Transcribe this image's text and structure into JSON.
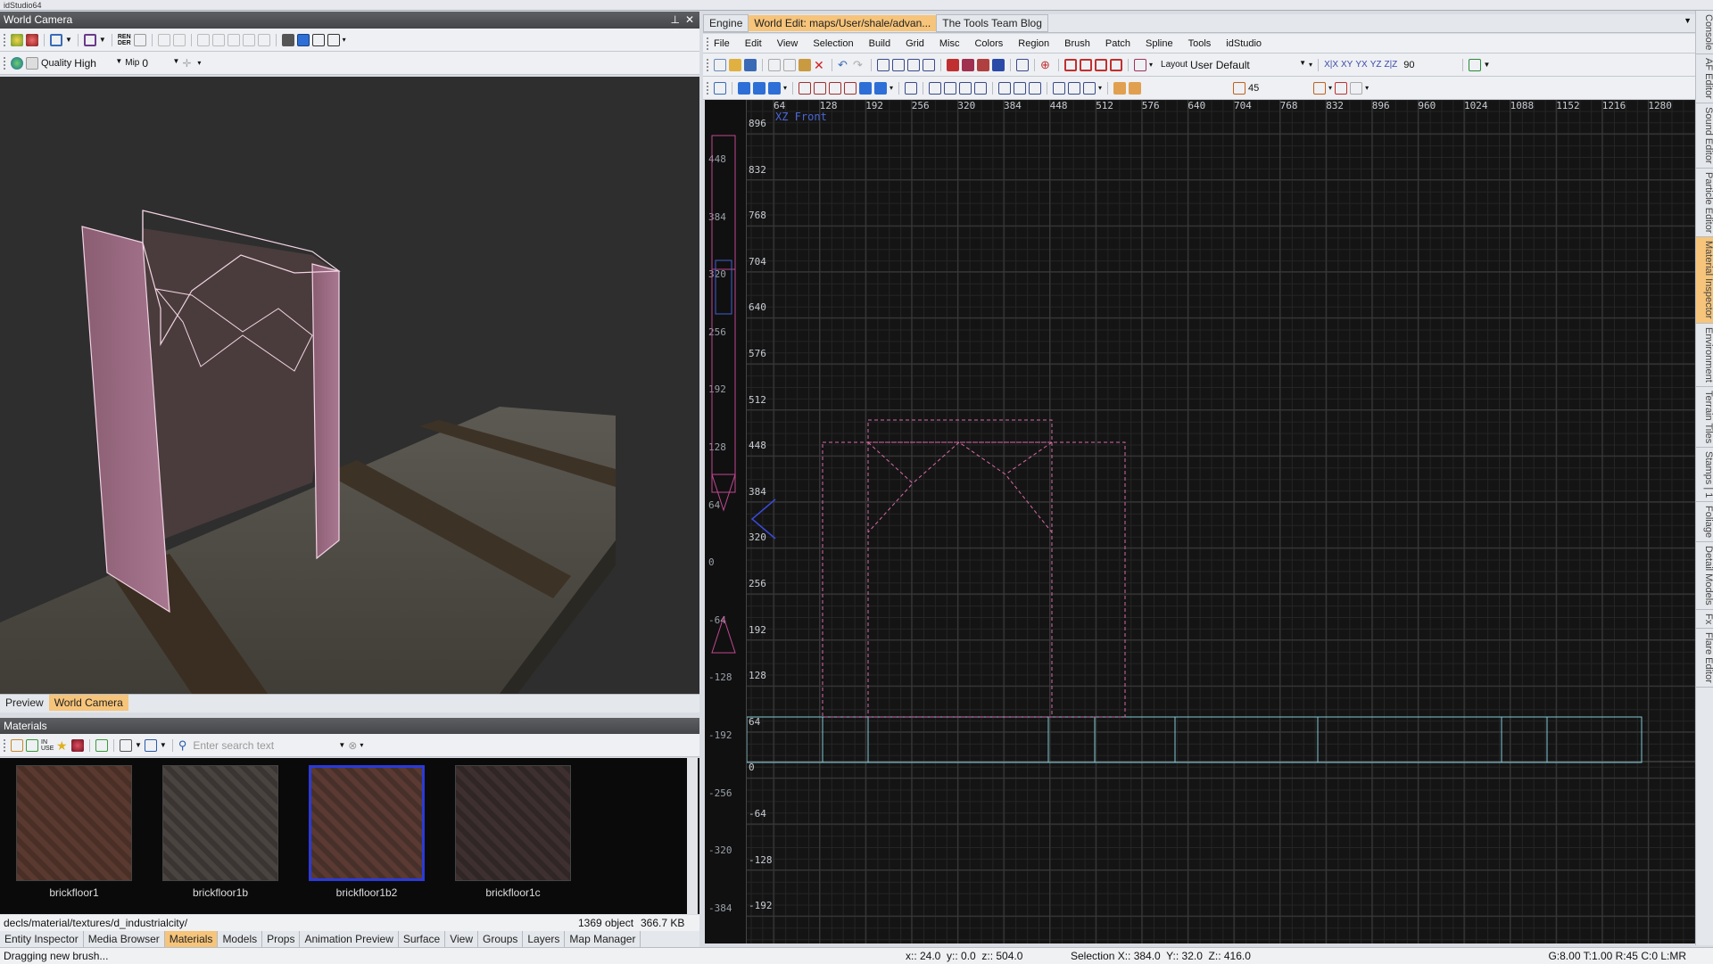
{
  "app": {
    "title": "idStudio64"
  },
  "camera_panel": {
    "title": "World Camera",
    "quality_label": "Quality",
    "quality_value": "High",
    "mip_label": "Mip",
    "mip_value": "0",
    "ren_der_label": "REN\nDER",
    "tabs": [
      {
        "label": "Preview"
      },
      {
        "label": "World Camera"
      }
    ]
  },
  "materials_panel": {
    "title": "Materials",
    "search_placeholder": "Enter search text",
    "items": [
      {
        "name": "brickfloor1"
      },
      {
        "name": "brickfloor1b"
      },
      {
        "name": "brickfloor1b2"
      },
      {
        "name": "brickfloor1c"
      }
    ],
    "path": "decls/material/textures/d_industrialcity/",
    "object_count": "1369 object",
    "size": "366.7 KB"
  },
  "bottom_tabs": [
    {
      "label": "Entity Inspector"
    },
    {
      "label": "Media Browser"
    },
    {
      "label": "Materials"
    },
    {
      "label": "Models"
    },
    {
      "label": "Props"
    },
    {
      "label": "Animation Preview"
    },
    {
      "label": "Surface"
    },
    {
      "label": "View"
    },
    {
      "label": "Groups"
    },
    {
      "label": "Layers"
    },
    {
      "label": "Map Manager"
    }
  ],
  "doc_tabs": [
    {
      "label": "Engine"
    },
    {
      "label": "World Edit: maps/User/shale/advan..."
    },
    {
      "label": "The Tools Team Blog"
    }
  ],
  "menu": [
    {
      "label": "File"
    },
    {
      "label": "Edit"
    },
    {
      "label": "View"
    },
    {
      "label": "Selection"
    },
    {
      "label": "Build"
    },
    {
      "label": "Grid"
    },
    {
      "label": "Misc"
    },
    {
      "label": "Colors"
    },
    {
      "label": "Region"
    },
    {
      "label": "Brush"
    },
    {
      "label": "Patch"
    },
    {
      "label": "Spline"
    },
    {
      "label": "Tools"
    },
    {
      "label": "idStudio"
    }
  ],
  "toolbar": {
    "layout_label": "Layout",
    "layout_value": "User Default",
    "rotate_value": "90",
    "angle_value": "45",
    "axis_labels": [
      "X|X",
      "XY",
      "YX",
      "YZ",
      "Z|Z"
    ]
  },
  "viewport": {
    "view_label": "XZ Front",
    "top_ruler": [
      "64",
      "128",
      "192",
      "256",
      "320",
      "384",
      "448",
      "512",
      "576",
      "640",
      "704",
      "768",
      "832",
      "896",
      "960",
      "1024",
      "1088",
      "1152",
      "1216",
      "1280"
    ],
    "left_ruler": [
      "896",
      "832",
      "768",
      "704",
      "640",
      "576",
      "512",
      "448",
      "384",
      "320",
      "256",
      "192",
      "128",
      "64",
      "0",
      "-64",
      "-128",
      "-192"
    ],
    "side_ruler": [
      "448",
      "384",
      "320",
      "256",
      "192",
      "128",
      "64",
      "0",
      "-64",
      "-128",
      "-192",
      "-256",
      "-320",
      "-384"
    ]
  },
  "right_dock_tabs": [
    {
      "label": "Console"
    },
    {
      "label": "AF Editor"
    },
    {
      "label": "Sound Editor"
    },
    {
      "label": "Particle Editor"
    },
    {
      "label": "Material Inspector"
    },
    {
      "label": "Environment"
    },
    {
      "label": "Terrain Tiles"
    },
    {
      "label": "Stamps | 1"
    },
    {
      "label": "Foliage"
    },
    {
      "label": "Detail Models"
    },
    {
      "label": "Fx"
    },
    {
      "label": "Flare Editor"
    }
  ],
  "status_bar": {
    "message": "Dragging new brush...",
    "cursor": "x:: 24.0  y:: 0.0  z:: 504.0",
    "selection": "Selection X:: 384.0  Y:: 32.0  Z:: 416.0",
    "grid": "G:8.00 T:1.00 R:45 C:0 L:MR"
  },
  "colors": {
    "accent": "#f6c47a",
    "viewport_bg": "#141414",
    "brush_pink": "#d96aa8",
    "floor_cyan": "#7fc7d6"
  }
}
